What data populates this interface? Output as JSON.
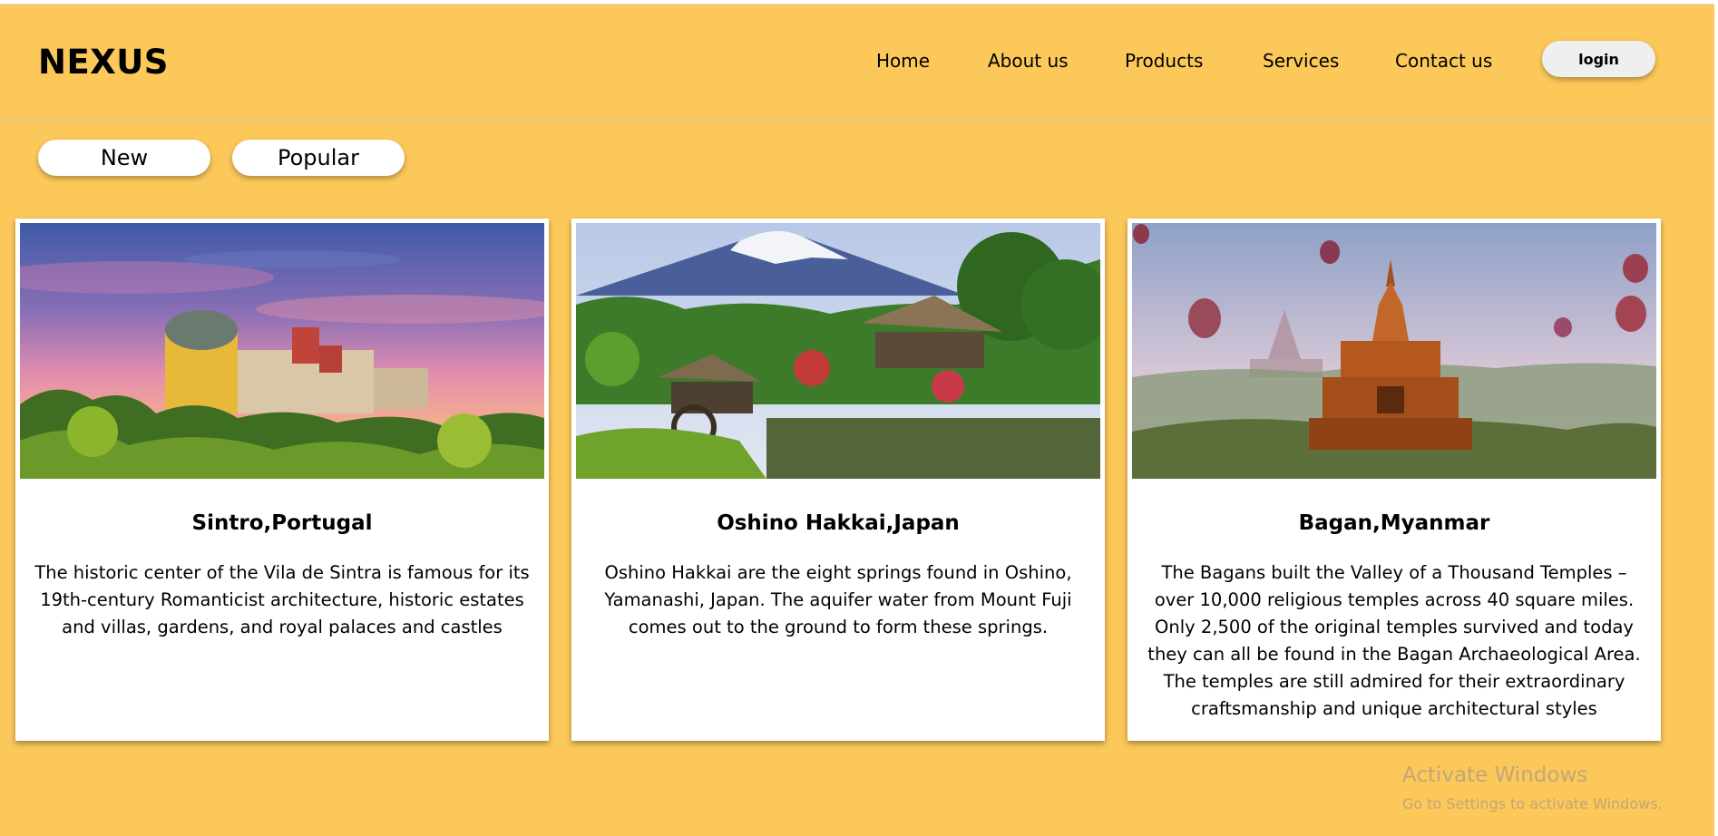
{
  "header": {
    "logo": "NEXUS",
    "nav": [
      "Home",
      "About us",
      "Products",
      "Services",
      "Contact us"
    ],
    "login_label": "login"
  },
  "filters": [
    "New",
    "Popular"
  ],
  "cards": [
    {
      "title": "Sintro,Portugal",
      "text": "The historic center of the Vila de Sintra is famous for its 19th-century Romanticist architecture, historic estates and villas, gardens, and royal palaces and castles"
    },
    {
      "title": "Oshino Hakkai,Japan",
      "text": "Oshino Hakkai are the eight springs found in Oshino, Yamanashi, Japan. The aquifer water from Mount Fuji comes out to the ground to form these springs."
    },
    {
      "title": "Bagan,Myanmar",
      "text": "The Bagans built the Valley of a Thousand Temples – over 10,000 religious temples across 40 square miles. Only 2,500 of the original temples survived and today they can all be found in the Bagan Archaeological Area. The temples are still admired for their extraordinary craftsmanship and unique architectural styles"
    }
  ],
  "watermark": {
    "line1": "Activate Windows",
    "line2": "Go to Settings to activate Windows."
  },
  "colors": {
    "background": "#fcc85a",
    "card": "#ffffff",
    "button": "#efefef"
  }
}
